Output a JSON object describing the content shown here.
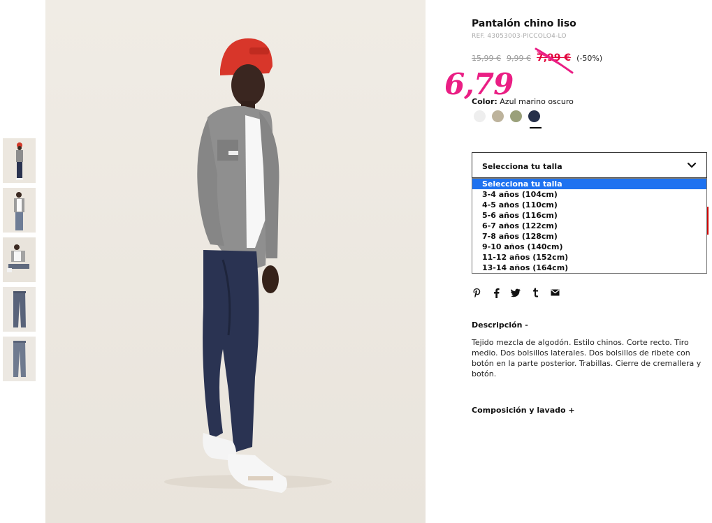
{
  "product": {
    "title": "Pantalón chino liso",
    "ref": "REF. 43053003-PICCOLO4-LO",
    "prices": {
      "original": "15,99 €",
      "previous": "9,99 €",
      "sale": "7,99 €",
      "discount": "(-50%)"
    },
    "handwritten_price": "6,79",
    "color_label": "Color:",
    "color_value": "Azul marino oscuro",
    "swatches": [
      {
        "name": "blanco",
        "color": "#eeeeee"
      },
      {
        "name": "beige",
        "color": "#bdb39c"
      },
      {
        "name": "verde",
        "color": "#9aa07a"
      },
      {
        "name": "azul-marino",
        "color": "#26304a"
      }
    ]
  },
  "size_select": {
    "label": "Selecciona tu talla",
    "options": [
      "Selecciona tu talla",
      "3-4 años (104cm)",
      "4-5 años (110cm)",
      "5-6 años (116cm)",
      "6-7 años (122cm)",
      "7-8 años (128cm)",
      "9-10 años (140cm)",
      "11-12 años (152cm)",
      "13-14 años (164cm)"
    ],
    "selected_index": 0
  },
  "social": {
    "pinterest": "P",
    "facebook": "f",
    "twitter": "t",
    "tumblr": "t",
    "email": "✉"
  },
  "description": {
    "heading": "Descripción -",
    "text": "Tejido mezcla de algodón. Estilo chinos. Corte recto. Tiro medio. Dos bolsillos laterales. Dos bolsillos de ribete con botón en la parte posterior. Trabillas. Cierre de cremallera y botón."
  },
  "composition": {
    "heading": "Composición y lavado +"
  },
  "colors": {
    "sale_red": "#e2003a",
    "handwritten_pink": "#ea1e84",
    "dropdown_highlight": "#1e72f0",
    "photo_background": "#efebe4"
  }
}
